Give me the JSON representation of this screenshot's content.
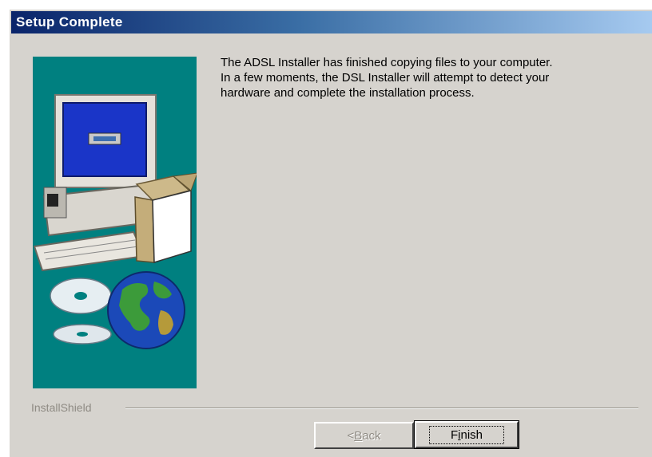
{
  "window": {
    "title": "Setup Complete"
  },
  "message": {
    "line1": "The ADSL Installer has finished copying files to your computer.",
    "line2": "In a few moments, the DSL Installer will attempt to detect your",
    "line3": "hardware and complete the installation process."
  },
  "footer": {
    "brand": "InstallShield"
  },
  "buttons": {
    "back": {
      "prefix": "< ",
      "mnemonic": "B",
      "rest": "ack",
      "enabled": false
    },
    "finish": {
      "prefix": "F",
      "mnemonic": "i",
      "rest": "nish",
      "enabled": true
    }
  },
  "colors": {
    "title_bar_start": "#0a246a",
    "title_bar_end": "#a6caf0",
    "dialog_face": "#d6d3ce",
    "side_panel": "#008080"
  },
  "icons": [
    "computer-icon",
    "open-box-icon",
    "cd-discs-icon",
    "globe-icon"
  ]
}
